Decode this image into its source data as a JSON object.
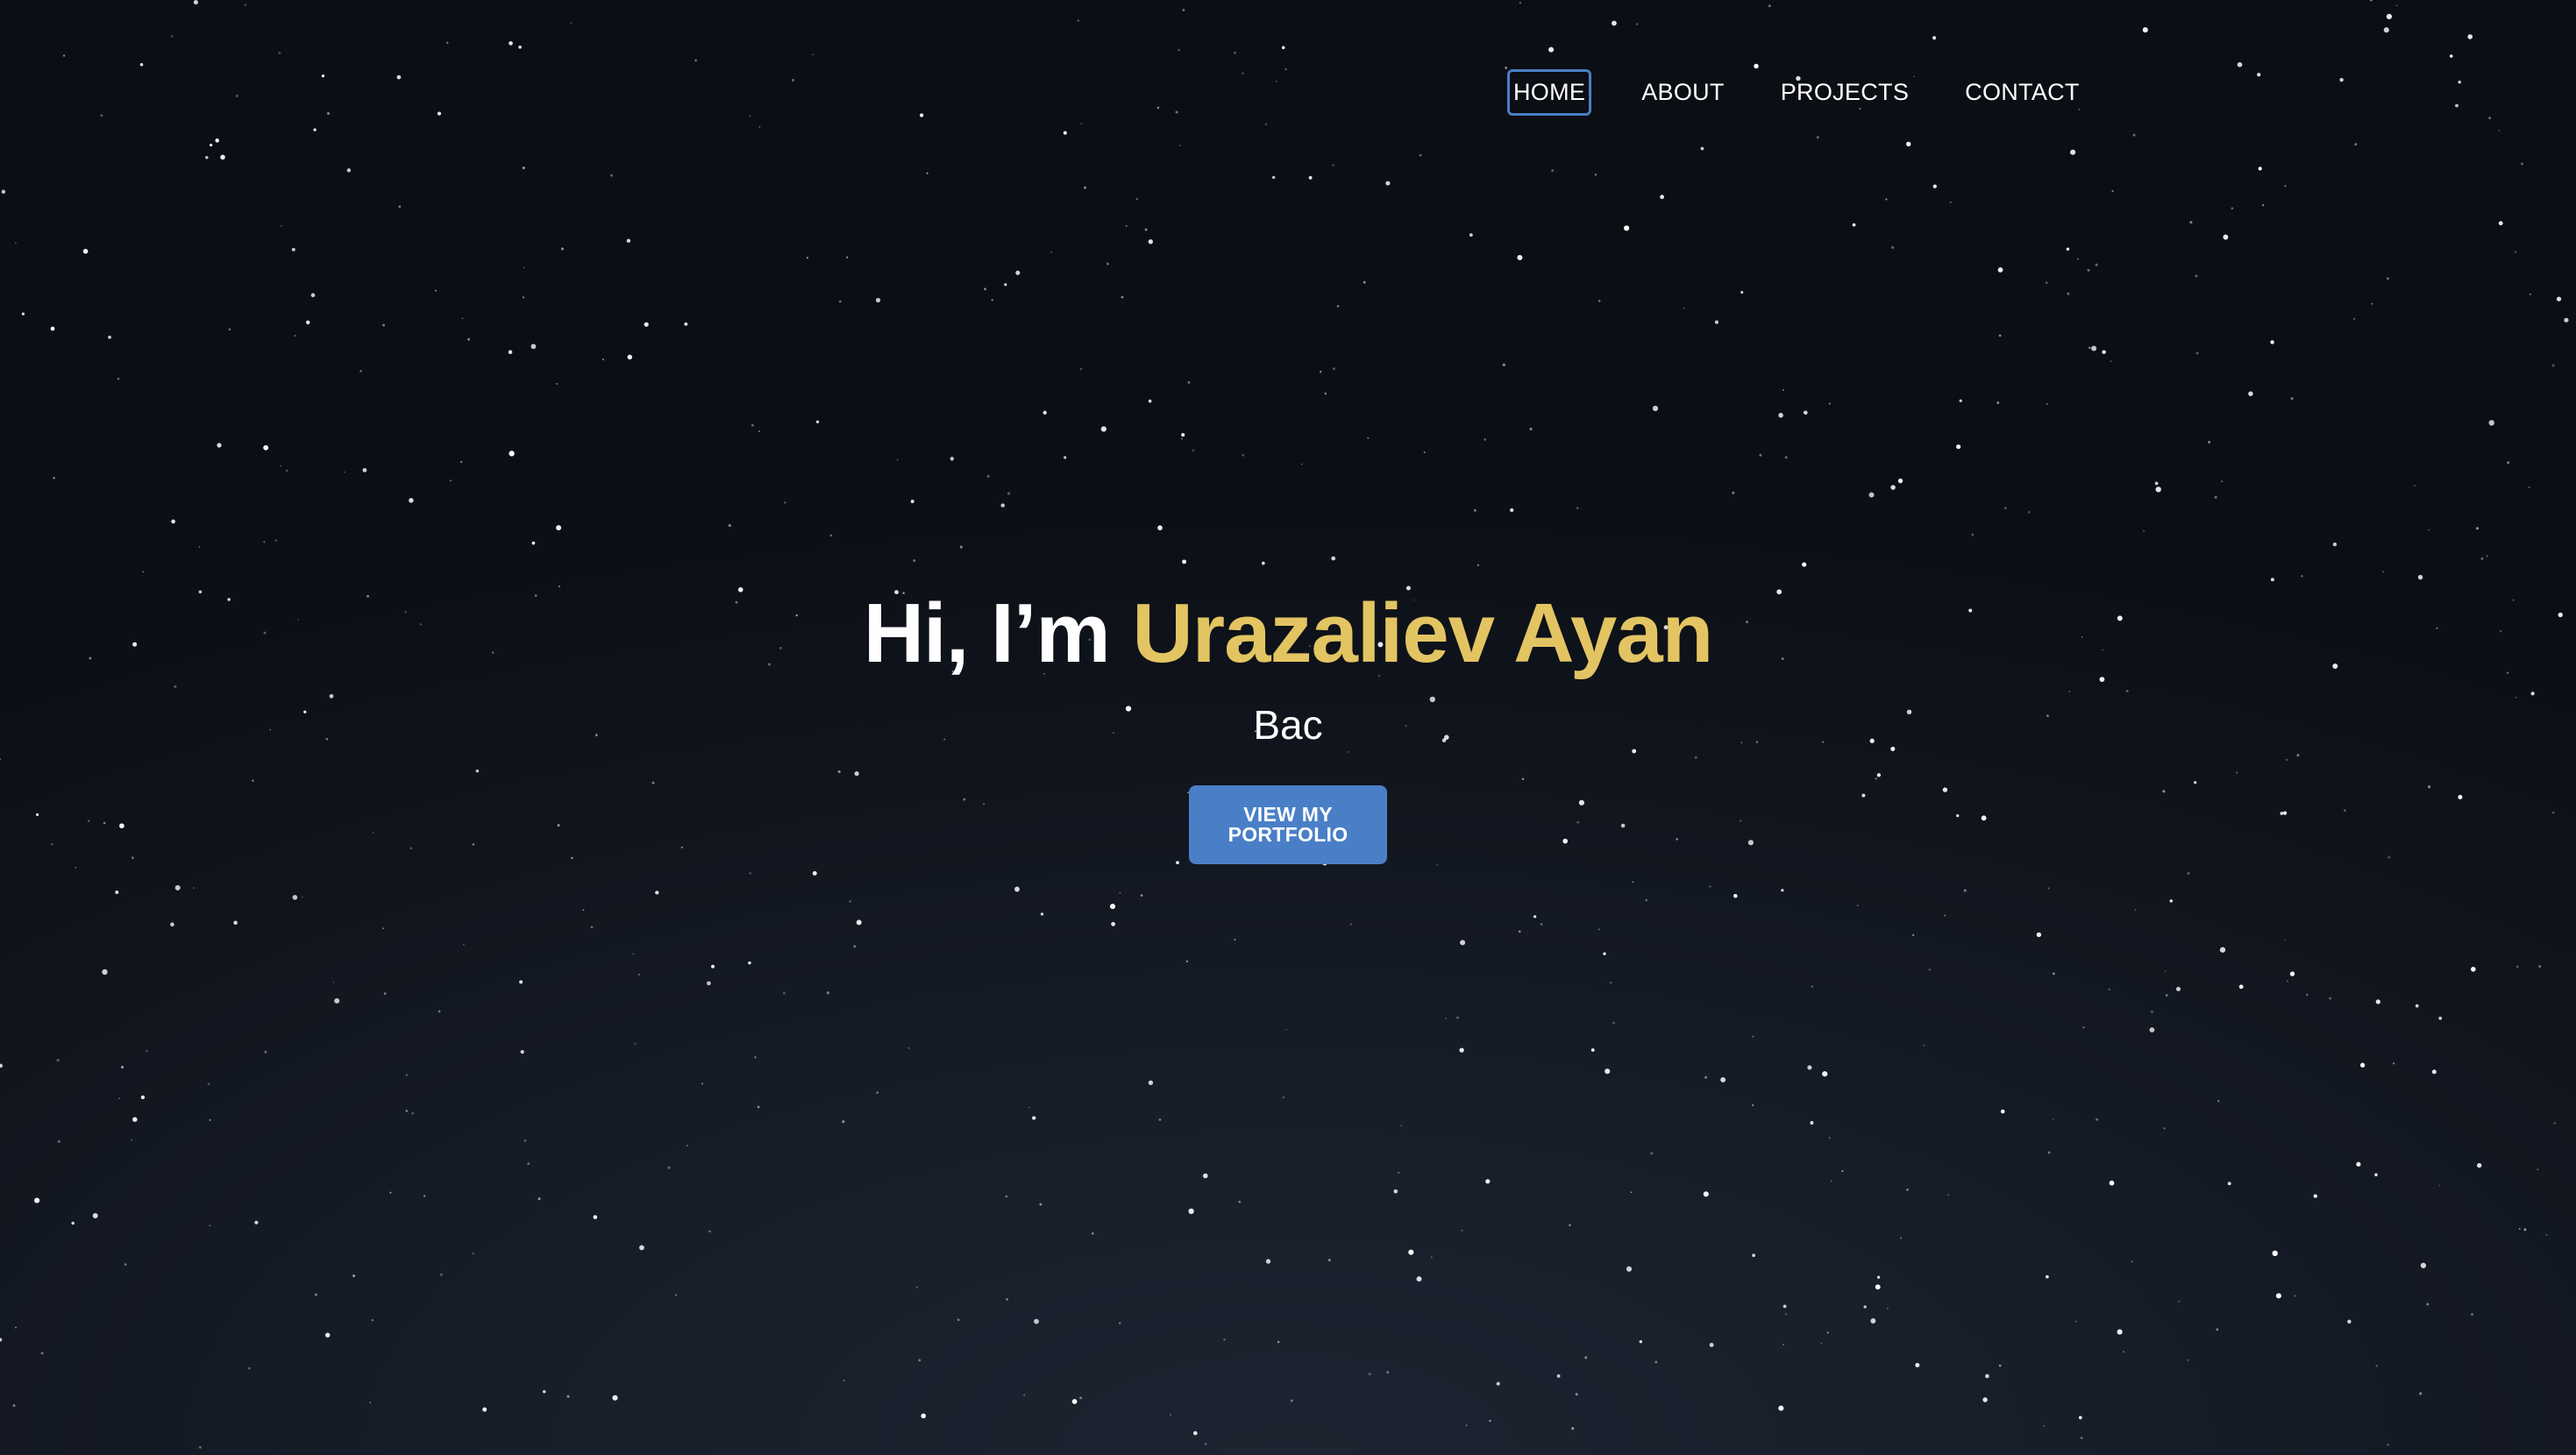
{
  "nav": {
    "items": [
      {
        "label": "HOME",
        "active": true
      },
      {
        "label": "ABOUT",
        "active": false
      },
      {
        "label": "PROJECTS",
        "active": false
      },
      {
        "label": "CONTACT",
        "active": false
      }
    ]
  },
  "hero": {
    "greeting": "Hi, I’m",
    "name": "Urazaliev Ayan",
    "subtitle": "Bac",
    "cta_label": "VIEW MY PORTFOLIO"
  },
  "colors": {
    "background": "#0f131b",
    "name_accent": "#e3c462",
    "button": "#4a7fc7",
    "active_outline": "#4a7fc4",
    "star": "#ffffff"
  }
}
